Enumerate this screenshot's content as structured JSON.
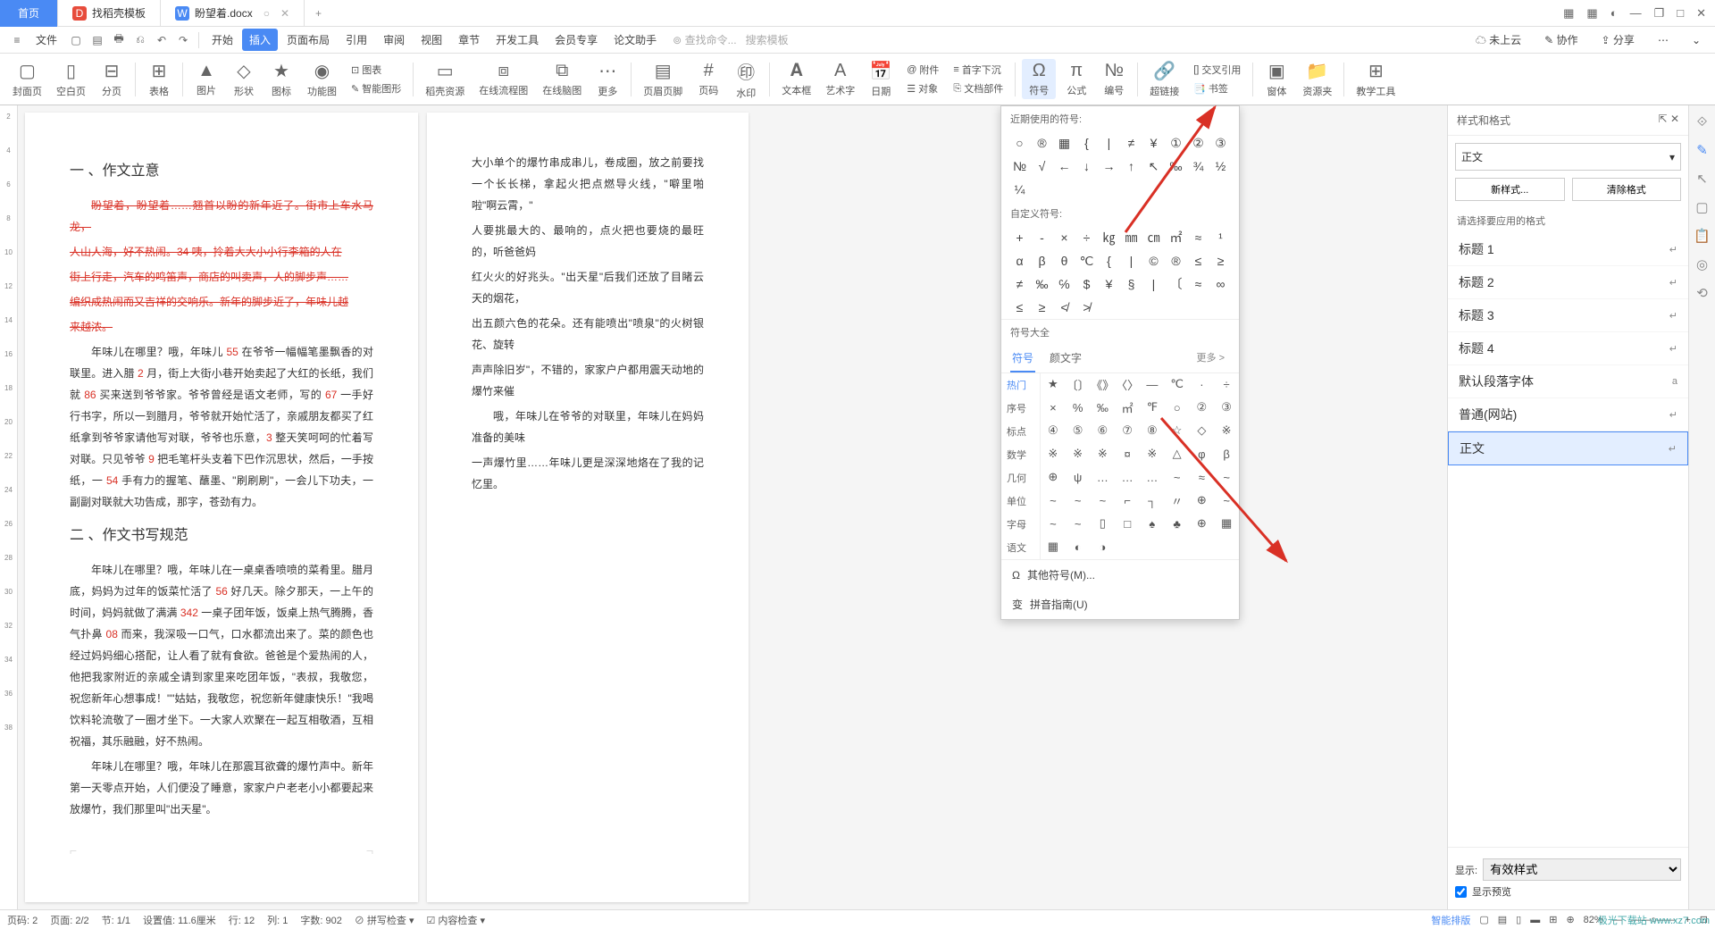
{
  "tabs": {
    "home": "首页",
    "tpl": "找稻壳模板",
    "doc": "盼望着.docx",
    "unsaved": "○",
    "new": "+"
  },
  "win": {
    "grid": "▦",
    "app": "▦",
    "avatar": "◐",
    "min": "—",
    "max": "□",
    "close": "✕",
    "restore": "❐"
  },
  "menu": {
    "file_icon": "≡",
    "file": "文件",
    "qk": [
      "▢",
      "▤",
      "🖶",
      "⎌",
      "↶",
      "↷"
    ],
    "items": [
      "开始",
      "插入",
      "页面布局",
      "引用",
      "审阅",
      "视图",
      "章节",
      "开发工具",
      "会员专享",
      "论文助手"
    ],
    "search_ph": "查找命令...",
    "tpl_ph": "搜索模板",
    "right": {
      "cloud": "☁ 未上云",
      "coop": "✎ 协作",
      "share": "⇪ 分享",
      "menu": "⋯",
      "drop": "⌄"
    }
  },
  "ribbon": {
    "g1": [
      {
        "i": "▢",
        "l": "封面页"
      },
      {
        "i": "▯",
        "l": "空白页"
      },
      {
        "i": "⊟",
        "l": "分页"
      }
    ],
    "g2": [
      {
        "i": "⊞",
        "l": "表格"
      }
    ],
    "g3": [
      {
        "i": "▲",
        "l": "图片"
      },
      {
        "i": "◇",
        "l": "形状"
      },
      {
        "i": "★",
        "l": "图标"
      },
      {
        "i": "◉",
        "l": "功能图"
      }
    ],
    "g3b": [
      {
        "i": "⊡",
        "l": "图表"
      },
      {
        "i": "✎",
        "l": "智能图形"
      }
    ],
    "g4": [
      {
        "i": "▭",
        "l": "稻壳资源"
      },
      {
        "i": "⧈",
        "l": "在线流程图"
      },
      {
        "i": "⧉",
        "l": "在线脑图"
      },
      {
        "i": "⋯",
        "l": "更多"
      }
    ],
    "g5": [
      {
        "i": "▤",
        "l": "页眉页脚"
      },
      {
        "i": "#",
        "l": "页码"
      },
      {
        "i": "㊞",
        "l": "水印"
      }
    ],
    "g6": [
      {
        "i": "𝐀",
        "l": "文本框"
      },
      {
        "i": "A",
        "l": "艺术字"
      },
      {
        "i": "📅",
        "l": "日期"
      }
    ],
    "g6b": [
      {
        "i": "@",
        "l": "附件"
      },
      {
        "i": "☰",
        "l": "对象"
      }
    ],
    "g6c": [
      {
        "i": "≡",
        "l": "首字下沉"
      },
      {
        "i": "⎘",
        "l": "文档部件"
      }
    ],
    "g7": [
      {
        "i": "Ω",
        "l": "符号"
      },
      {
        "i": "π",
        "l": "公式"
      },
      {
        "i": "№",
        "l": "编号"
      }
    ],
    "g8": [
      {
        "i": "🔗",
        "l": "超链接"
      }
    ],
    "g8b": [
      {
        "i": "[]",
        "l": "交叉引用"
      },
      {
        "i": "📑",
        "l": "书签"
      }
    ],
    "g9": [
      {
        "i": "▣",
        "l": "窗体"
      },
      {
        "i": "📁",
        "l": "资源夹"
      }
    ],
    "g10": [
      {
        "i": "⊞",
        "l": "教学工具"
      }
    ]
  },
  "doc": {
    "h1": "一 、作文立意",
    "strike": [
      "盼望着，盼望着……翘首以盼的新年近了。街市上车水马龙，",
      "人山人海，好不热闹。34 咦，拎着大大小小行李箱的人在",
      "街上行走，汽车的鸣笛声，商店的叫卖声，人的脚步声……",
      "编织成热闹而又吉祥的交响乐。新年的脚步近了，年味儿越",
      "来越浓。"
    ],
    "p1a": "年味儿在哪里？哦，年味儿 ",
    "n1": "55",
    "p1b": " 在爷爷一幅幅笔墨飘香的对联里。进入腊 ",
    "n2": "2",
    "p1c": " 月，街上大街小巷开始卖起了大红的长纸，我们就 ",
    "n3": "86",
    "p1d": " 买来送到爷爷家。爷爷曾经是语文老师，写的 ",
    "n4": "67",
    "p1e": " 一手好行书字，所以一到腊月，爷爷就开始忙活了，亲戚朋友都买了红纸拿到爷爷家请他写对联，爷爷也乐意，",
    "n5": "3",
    "p1f": " 整天笑呵呵的忙着写对联。只见爷爷 ",
    "n6": "9",
    "p1g": " 把毛笔杆头支着下巴作沉思状，然后，一手按纸，一 ",
    "n7": "54",
    "p1h": " 手有力的握笔、蘸墨、\"刷刷刷\"，一会儿下功夫，一副副对联就大功告成，那字，苍劲有力。",
    "h2": "二 、作文书写规范",
    "p2a": "年味儿在哪里？哦，年味儿在一桌桌香喷喷的菜肴里。腊月底，妈妈为过年的饭菜忙活了 ",
    "n8": "56",
    "p2b": " 好几天。除夕那天，一上午的时间，妈妈就做了满满 ",
    "n9": "342",
    "p2c": " 一桌子团年饭，饭桌上热气腾腾，香气扑鼻 ",
    "n10": "08",
    "p2d": " 而来，我深吸一口气，口水都流出来了。菜的颜色也经过妈妈细心搭配，让人看了就有食欲。爸爸是个爱热闹的人，他把我家附近的亲戚全请到家里来吃团年饭，\"表叔，我敬您，祝您新年心想事成！\"\"姑姑，我敬您，祝您新年健康快乐！\"我喝饮料轮流敬了一圈才坐下。一大家人欢聚在一起互相敬酒，互相祝福，其乐融融，好不热闹。",
    "p3": "年味儿在哪里？哦，年味儿在那震耳欲聋的爆竹声中。新年第一天零点开始，人们便没了睡意，家家户户老老小小都要起来放爆竹，我们那里叫\"出天星\"。",
    "r1": "大小单个的爆竹串成串儿，卷成圈，放之前要找一个长长梯，拿起火把点燃导火线，\"噼里啪啦\"啊云霄，\"",
    "r2": "人要挑最大的、最响的，点火把也要烧的最旺的，听爸爸妈",
    "r3": "红火火的好兆头。\"出天星\"后我们还放了目睹云天的烟花，",
    "r4": "出五颜六色的花朵。还有能喷出\"喷泉\"的火树银花、旋转",
    "r5": "声声除旧岁\"，不错的，家家户户都用震天动地的爆竹来催",
    "r6": "哦，年味儿在爷爷的对联里，年味儿在妈妈准备的美味",
    "r7": "一声爆竹里……年味儿更是深深地烙在了我的记忆里。"
  },
  "sympop": {
    "recent": "近期使用的符号:",
    "recent_syms": [
      "○",
      "®",
      "▦",
      "{",
      "|",
      "≠",
      "¥",
      "①",
      "②",
      "③",
      "№",
      "√",
      "←",
      "↓",
      "→",
      "↑",
      "↖",
      "‰",
      "¾",
      "½",
      "¼"
    ],
    "custom": "自定义符号:",
    "custom_syms": [
      "+",
      "-",
      "×",
      "÷",
      "㎏",
      "㎜",
      "㎝",
      "㎡",
      "≈",
      "¹",
      "α",
      "β",
      "θ",
      "℃",
      "{",
      "|",
      "©",
      "®",
      "≤",
      "≥",
      "≠",
      "‰",
      "℅",
      "$",
      "¥",
      "§",
      "|",
      "〔",
      "≈",
      "∞",
      "≤",
      "≥",
      "≮",
      "≯"
    ],
    "all": "符号大全",
    "tabs": [
      "符号",
      "颜文字"
    ],
    "more": "更多 >",
    "cats": [
      "热门",
      "序号",
      "标点",
      "数学",
      "几何",
      "单位",
      "字母",
      "语文"
    ],
    "grid": [
      "★",
      "〔〕",
      "《》",
      "〈〉",
      "—",
      "℃",
      "·",
      "÷",
      "×",
      "%",
      "‰",
      "㎡",
      "℉",
      "○",
      "②",
      "③",
      "④",
      "⑤",
      "⑥",
      "⑦",
      "⑧",
      "☆",
      "◇",
      "※",
      "※",
      "※",
      "※",
      "¤",
      "※",
      "△",
      "φ",
      "β",
      "⊕",
      "ψ",
      "…",
      "…",
      "…",
      "~",
      "≈",
      "~",
      "~",
      "~",
      "~",
      "⌐",
      "┐",
      "〃",
      "⊕",
      "~",
      "~",
      "~",
      "▯",
      "□",
      "♠",
      "♣",
      "⊕",
      "▦",
      "▦",
      "◐",
      "◑"
    ],
    "other": "其他符号(M)...",
    "pinyin": "拼音指南(U)"
  },
  "styles": {
    "title": "样式和格式",
    "cur": "正文",
    "new": "新样式...",
    "clear": "清除格式",
    "note": "请选择要应用的格式",
    "list": [
      {
        "n": "标题 1",
        "i": "↵"
      },
      {
        "n": "标题 2",
        "i": "↵"
      },
      {
        "n": "标题 3",
        "i": "↵"
      },
      {
        "n": "标题 4",
        "i": "↵"
      },
      {
        "n": "默认段落字体",
        "i": "a"
      },
      {
        "n": "普通(网站)",
        "i": "↵"
      },
      {
        "n": "正文",
        "i": "↵"
      }
    ],
    "show": "显示:",
    "show_v": "有效样式",
    "preview": "显示预览"
  },
  "status": {
    "l": [
      "页码: 2",
      "页面: 2/2",
      "节: 1/1",
      "设置值: 11.6厘米",
      "行: 12",
      "列: 1",
      "字数: 902",
      "⊘ 拼写检查 ▾",
      "☑ 内容检查 ▾"
    ],
    "r": [
      "智能排版",
      "▢",
      "▤",
      "▯",
      "▬",
      "⊞",
      "⊕",
      "82%",
      "—",
      "——○——",
      "+",
      "⊡"
    ]
  },
  "watermark": "极光下载站\nwww.xz7.com"
}
